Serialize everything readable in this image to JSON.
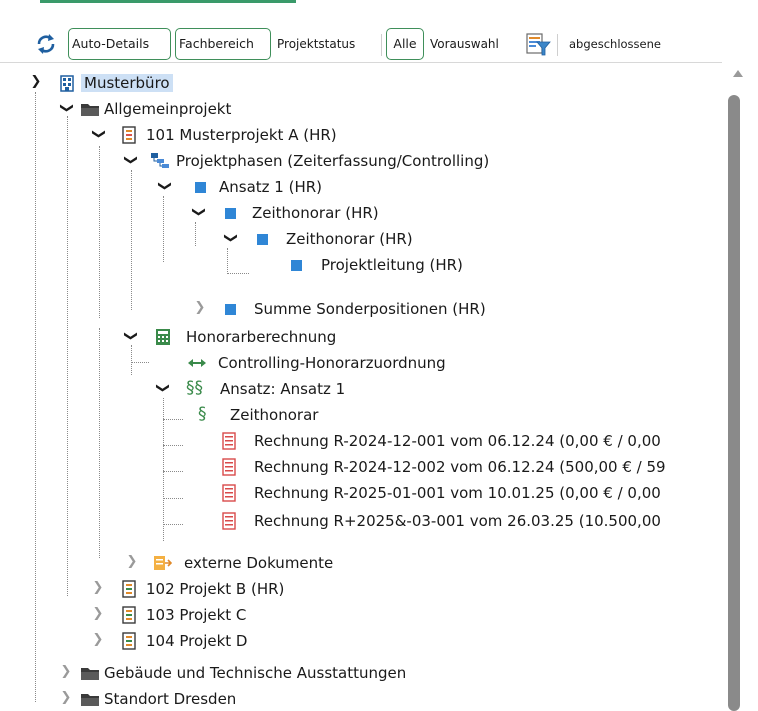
{
  "toolbar": {
    "refresh_icon": "refresh-icon",
    "auto_details": "Auto-Details",
    "fachbereich": "Fachbereich",
    "projektstatus": "Projektstatus",
    "alle": "Alle",
    "vorauswahl": "Vorauswahl",
    "filter_icon": "filter-icon",
    "abgeschlossene": "abgeschlossene"
  },
  "tree": {
    "root": "Musterbüro",
    "allgemeinprojekt": "Allgemeinprojekt",
    "projekt_101": "101 Musterprojekt A (HR)",
    "projektphasen": "Projektphasen (Zeiterfassung/Controlling)",
    "ansatz1": "Ansatz 1 (HR)",
    "zeithonorar_1": "Zeithonorar (HR)",
    "zeithonorar_2": "Zeithonorar (HR)",
    "projektleitung": "Projektleitung (HR)",
    "summe_sonderpositionen": "Summe Sonderpositionen (HR)",
    "honorarberechnung": "Honorarberechnung",
    "controlling_zuordnung": "Controlling-Honorarzuordnung",
    "ansatz_ansatz1": "Ansatz: Ansatz 1",
    "zeithonorar_paragraph": "Zeithonorar",
    "rechnung_1": "Rechnung R-2024-12-001 vom 06.12.24 (0,00 € / 0,00",
    "rechnung_2": "Rechnung R-2024-12-002 vom 06.12.24 (500,00 € / 59",
    "rechnung_3": "Rechnung R-2025-01-001 vom 10.01.25 (0,00 € / 0,00",
    "rechnung_4": "Rechnung R+2025&-03-001 vom 26.03.25 (10.500,00",
    "externe_dokumente": "externe Dokumente",
    "projekt_102": "102 Projekt B (HR)",
    "projekt_103": "103 Projekt C",
    "projekt_104": "104 Projekt D",
    "gebaeude": "Gebäude und Technische Ausstattungen",
    "standort": "Standort Dresden"
  },
  "colors": {
    "accent_green": "#3f8f5a",
    "selection": "#cde0f5",
    "blue_square": "#2f86d6",
    "invoice_red": "#d94a4a"
  }
}
